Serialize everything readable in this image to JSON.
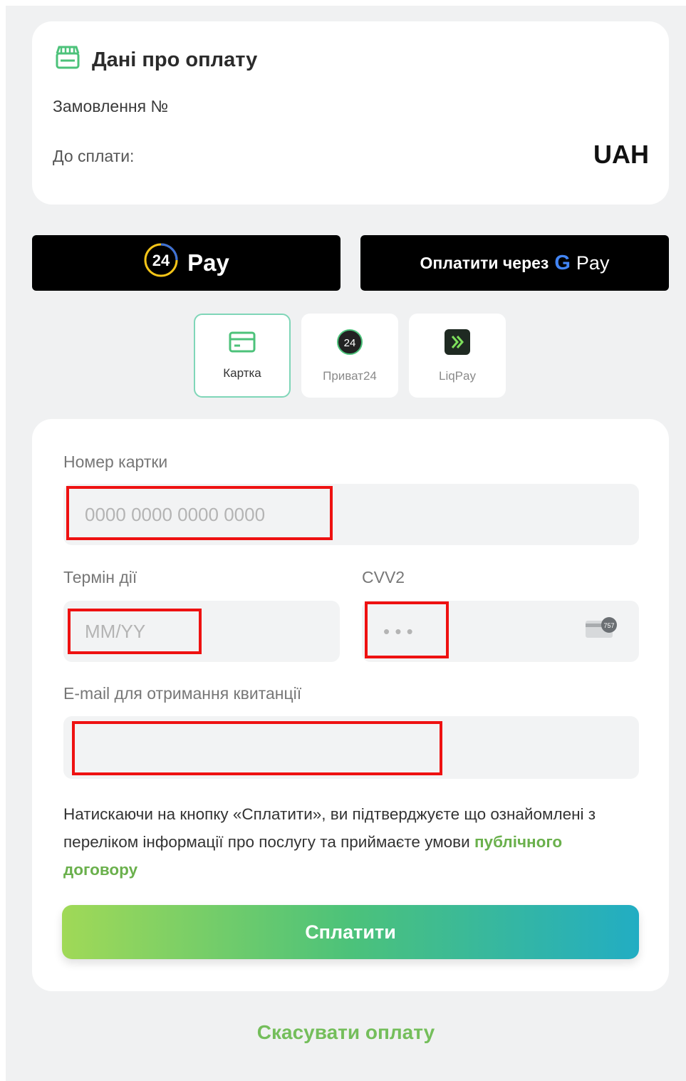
{
  "payment_info": {
    "title": "Дані про оплату",
    "order_label": "Замовлення №",
    "due_label": "До сплати:",
    "currency": "UAH"
  },
  "wallets": {
    "privat_pay_badge": "24",
    "privat_pay_label": "Pay",
    "google_pay_prefix": "Оплатити через",
    "google_pay_g": "G",
    "google_pay_label": "Pay"
  },
  "method_tabs": [
    {
      "label": "Картка",
      "icon": "card-icon",
      "active": true
    },
    {
      "label": "Приват24",
      "icon": "privat24-icon",
      "badge": "24",
      "active": false
    },
    {
      "label": "LiqPay",
      "icon": "liqpay-icon",
      "active": false
    }
  ],
  "form": {
    "card_number_label": "Номер картки",
    "card_number_placeholder": "0000 0000 0000 0000",
    "expiry_label": "Термін дії",
    "expiry_placeholder": "MM/YY",
    "cvv_label": "CVV2",
    "cvv_placeholder": "• • •",
    "cvv_card_hint": "757",
    "email_label": "E-mail для отримання квитанції",
    "email_value": ""
  },
  "consent": {
    "text": "Натискаючи на кнопку «Сплатити», ви підтверджуєте що ознайомлені з переліком інформації про послугу та приймаєте умови",
    "link": "публічного договору"
  },
  "submit_label": "Сплатити",
  "cancel_label": "Скасувати оплату",
  "colors": {
    "accent_green": "#74be5b",
    "highlight_red": "#ee1111",
    "gradient_start": "#a0d957",
    "gradient_end": "#22adc3"
  }
}
